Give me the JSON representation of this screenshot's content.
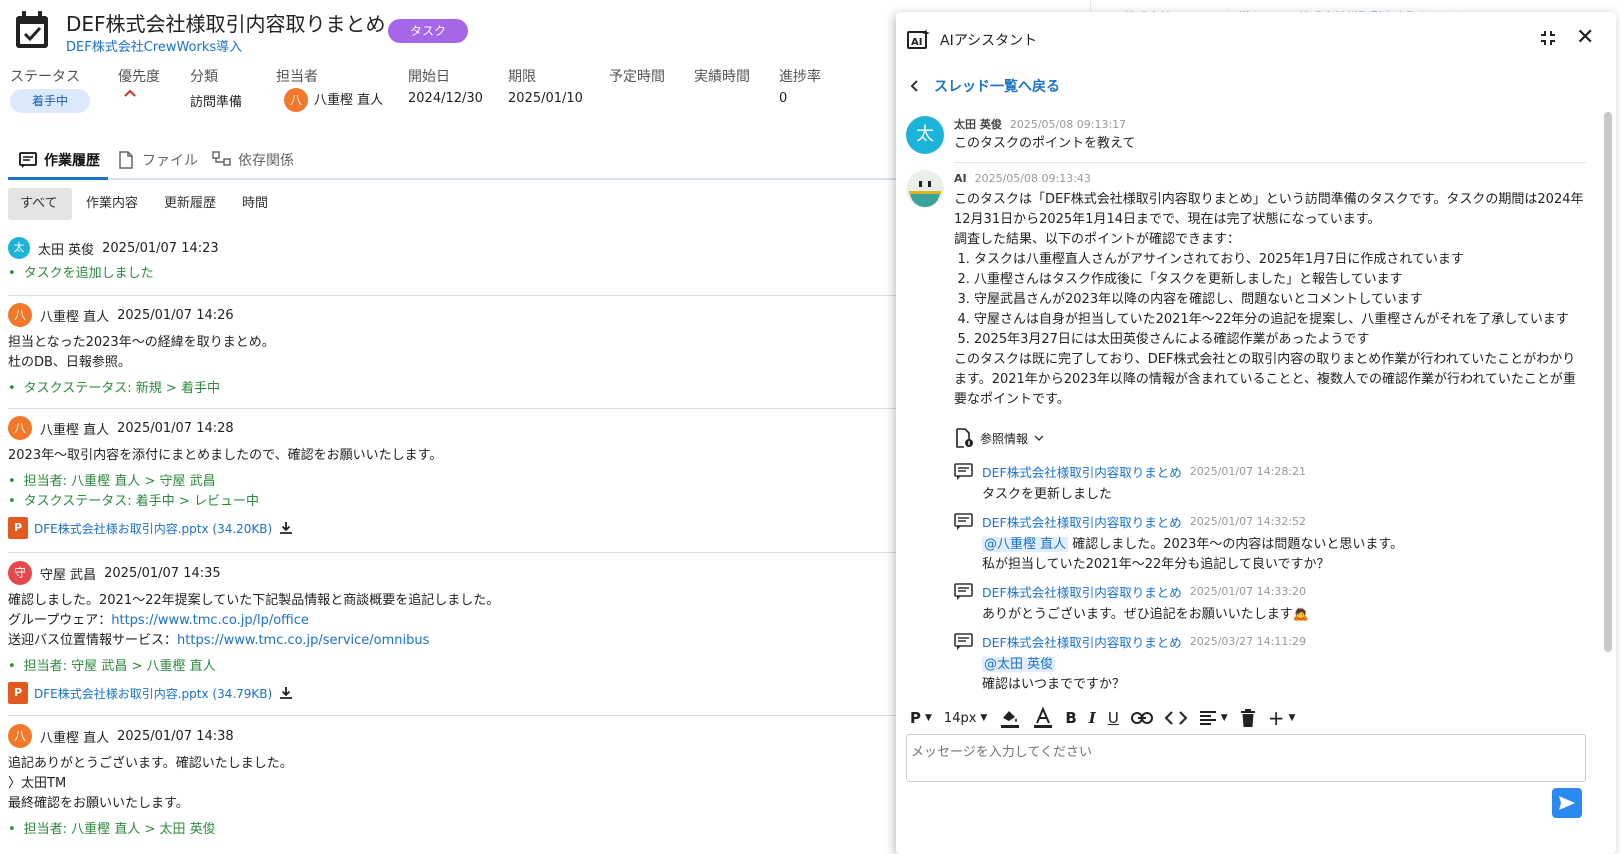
{
  "task": {
    "title": "DEF株式会社様取引内容取りまとめ",
    "badge": "タスク",
    "project": "DEF株式会社CrewWorks導入",
    "fields": {
      "status_label": "ステータス",
      "status_value": "着手中",
      "priority_label": "優先度",
      "category_label": "分類",
      "category_value": "訪問準備",
      "assignee_label": "担当者",
      "assignee_initial": "八",
      "assignee_name": "八重樫 直人",
      "start_label": "開始日",
      "start_value": "2024/12/30",
      "due_label": "期限",
      "due_value": "2025/01/10",
      "planned_label": "予定時間",
      "actual_label": "実績時間",
      "progress_label": "進捗率",
      "progress_value": "0"
    }
  },
  "tabs": [
    "作業履歴",
    "ファイル",
    "依存関係"
  ],
  "filters": [
    "すべて",
    "作業内容",
    "更新履歴",
    "時間"
  ],
  "history": [
    {
      "initial": "太",
      "name": "太田 英俊",
      "time": "2025/01/07 14:23",
      "changes": [
        "タスクを追加しました"
      ]
    },
    {
      "initial": "八",
      "name": "八重樫 直人",
      "time": "2025/01/07 14:26",
      "lines": [
        "担当となった2023年～の経緯を取りまとめ。",
        "杜のDB、日報参照。"
      ],
      "changes": [
        "タスクステータス: 新規 > 着手中"
      ]
    },
    {
      "initial": "八",
      "name": "八重樫 直人",
      "time": "2025/01/07 14:28",
      "lines": [
        "2023年～取引内容を添付にまとめましたので、確認をお願いいたします。"
      ],
      "changes": [
        "担当者: 八重樫 直人 > 守屋 武昌",
        "タスクステータス: 着手中 > レビュー中"
      ],
      "attachment": "DFE株式会社様お取引内容.pptx (34.20KB)"
    },
    {
      "initial": "守",
      "name": "守屋 武昌",
      "time": "2025/01/07 14:35",
      "lines": [
        "確認しました。2021～22年提案していた下記製品情報と商談概要を追記しました。"
      ],
      "link1_label": "グループウェア：",
      "link1": "https://www.tmc.co.jp/lp/office",
      "link2_label": "送迎バス位置情報サービス：",
      "link2": "https://www.tmc.co.jp/service/omnibus",
      "changes": [
        "担当者: 守屋 武昌 > 八重樫 直人"
      ],
      "attachment": "DFE株式会社様お取引内容.pptx (34.79KB)"
    },
    {
      "initial": "八",
      "name": "八重樫 直人",
      "time": "2025/01/07 14:38",
      "lines": [
        "追記ありがとうございます。確認いたしました。",
        "〉太田TM",
        "最終確認をお願いいたします。"
      ],
      "changes": [
        "担当者: 八重樫 直人 > 太田 英俊"
      ]
    }
  ],
  "behind_text": "DEF株式会社CrewWorks導入・DEF株式会社様取引内容取りまとめ",
  "ai": {
    "title": "AIアシスタント",
    "back": "スレッド一覧へ戻る",
    "user_msg": {
      "initial": "太",
      "name": "太田 英俊",
      "time": "2025/05/08 09:13:17",
      "text": "このタスクのポイントを教えて"
    },
    "ai_msg": {
      "name": "AI",
      "time": "2025/05/08 09:13:43",
      "intro": "このタスクは「DEF株式会社様取引内容取りまとめ」という訪問準備のタスクです。タスクの期間は2024年12月31日から2025年1月14日までで、現在は完了状態になっています。",
      "lead": "調査した結果、以下のポイントが確認できます：",
      "points": [
        "タスクは八重樫直人さんがアサインされており、2025年1月7日に作成されています",
        "八重樫さんはタスク作成後に「タスクを更新しました」と報告しています",
        "守屋武昌さんが2023年以降の内容を確認し、問題ないとコメントしています",
        "守屋さんは自身が担当していた2021年～22年分の追記を提案し、八重樫さんがそれを了承しています",
        "2025年3月27日には太田英俊さんによる確認作業があったようです"
      ],
      "summary": "このタスクは既に完了しており、DEF株式会社との取引内容の取りまとめ作業が行われていたことがわかります。2021年から2023年以降の情報が含まれていることと、複数人での確認作業が行われていたことが重要なポイントです。"
    },
    "ref_label": "参照情報",
    "refs": [
      {
        "title": "DEF株式会社様取引内容取りまとめ",
        "time": "2025/01/07 14:28:21",
        "text": "タスクを更新しました"
      },
      {
        "title": "DEF株式会社様取引内容取りまとめ",
        "time": "2025/01/07 14:32:52",
        "mention": "@八重樫 直人",
        "text": "確認しました。2023年～の内容は問題ないと思います。",
        "text2": "私が担当していた2021年～22年分も追記して良いですか？"
      },
      {
        "title": "DEF株式会社様取引内容取りまとめ",
        "time": "2025/01/07 14:33:20",
        "text": "ありがとうございます。ぜひ追記をお願いいたします🙇"
      },
      {
        "title": "DEF株式会社様取引内容取りまとめ",
        "time": "2025/03/27 14:11:29",
        "mention": "@太田 英俊",
        "text": "確認はいつまでですか？"
      }
    ],
    "toolbar": {
      "paragraph": "P",
      "font_size": "14px"
    },
    "input_placeholder": "メッセージを入力してください"
  }
}
